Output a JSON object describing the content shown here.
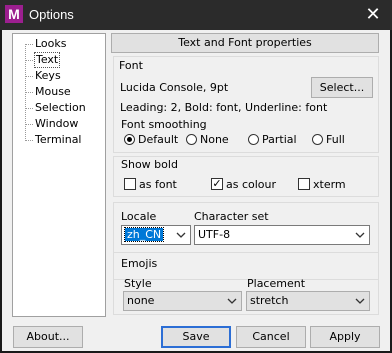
{
  "window": {
    "app_icon": "M",
    "title": "Options",
    "close_icon": "✕"
  },
  "tree": {
    "items": [
      "Looks",
      "Text",
      "Keys",
      "Mouse",
      "Selection",
      "Window",
      "Terminal"
    ],
    "selected": "Text"
  },
  "header_label": "Text and Font properties",
  "font_group": {
    "title": "Font",
    "font_value": "Lucida Console, 9pt",
    "select_button": "Select...",
    "details": "Leading: 2, Bold: font, Underline: font",
    "smoothing_label": "Font smoothing",
    "smoothing_options": [
      "Default",
      "None",
      "Partial",
      "Full"
    ],
    "smoothing_selected": "Default"
  },
  "bold_group": {
    "title": "Show bold",
    "options": [
      {
        "label": "as font",
        "checked": false
      },
      {
        "label": "as colour",
        "checked": true
      },
      {
        "label": "xterm",
        "checked": false
      }
    ]
  },
  "locale_group": {
    "locale_label": "Locale",
    "locale_value": "zh_CN",
    "charset_label": "Character set",
    "charset_value": "UTF-8"
  },
  "emojis_group": {
    "title": "Emojis",
    "style_label": "Style",
    "style_value": "none",
    "placement_label": "Placement",
    "placement_value": "stretch"
  },
  "buttons": {
    "about": "About...",
    "save": "Save",
    "cancel": "Cancel",
    "apply": "Apply"
  },
  "colors": {
    "titlebar": "#2b2b2b",
    "accent": "#0078d7",
    "app_icon": "#9c1f8f"
  }
}
